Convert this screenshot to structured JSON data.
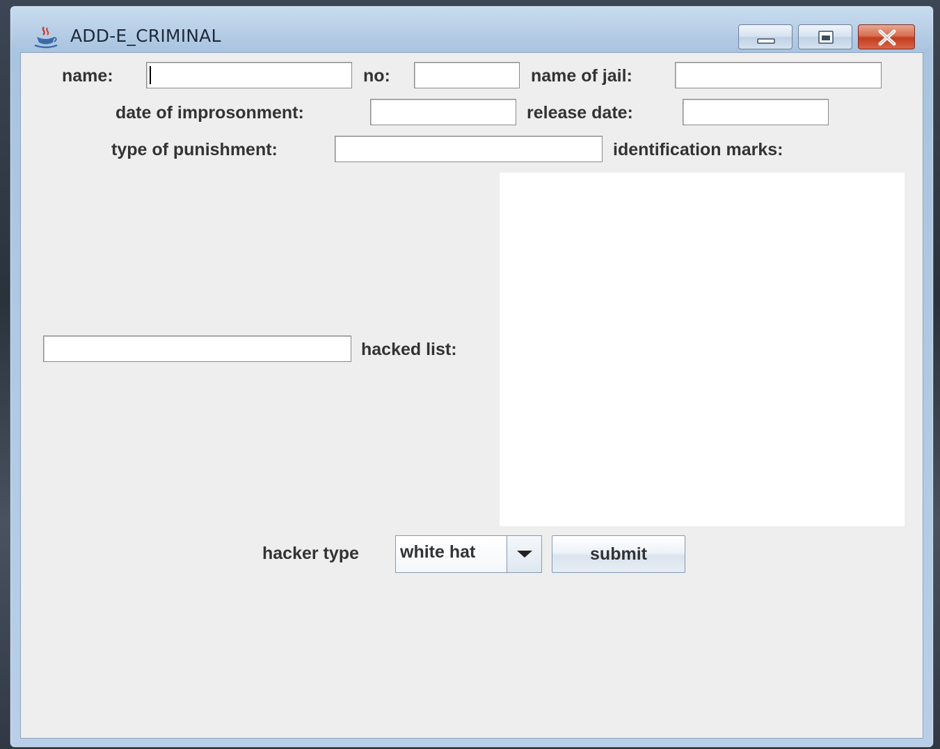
{
  "window": {
    "title": "ADD-E_CRIMINAL",
    "icon": "java-cup-icon",
    "controls": [
      "minimize-icon",
      "maximize-icon",
      "close-icon"
    ]
  },
  "form": {
    "name_label": "name:",
    "name_value": "",
    "no_label": "no:",
    "no_value": "",
    "jail_label": "name of jail:",
    "jail_value": "",
    "imprisonment_label": "date of improsonment:",
    "imprisonment_value": "",
    "release_label": "release date:",
    "release_value": "",
    "punishment_label": "type of punishment:",
    "punishment_value": "",
    "identification_label": "identification marks:",
    "identification_value": "",
    "hacked_list_value": "",
    "hacked_list_label": "hacked list:",
    "hacker_type_label": "hacker type",
    "hacker_type_selected": "white hat",
    "submit_label": "submit"
  },
  "colors": {
    "client_bg": "#eeeeee",
    "title_text": "#1d2a3a",
    "label_text": "#333333",
    "close_button": "#c23d1e"
  }
}
